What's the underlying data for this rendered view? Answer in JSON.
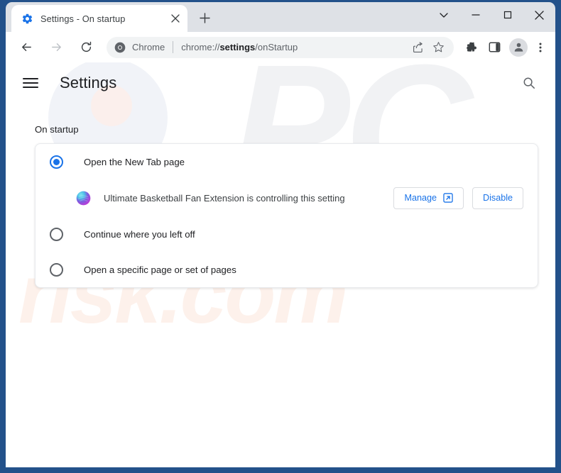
{
  "window": {
    "caption_buttons": [
      {
        "name": "tab-search",
        "icon": "chevron-down-icon"
      },
      {
        "name": "minimize",
        "icon": "minimize-icon"
      },
      {
        "name": "maximize",
        "icon": "maximize-icon"
      },
      {
        "name": "close",
        "icon": "close-icon"
      }
    ]
  },
  "tabs": [
    {
      "title": "Settings - On startup",
      "favicon": "settings-gear-icon",
      "close_icon": "close-icon",
      "active": true
    }
  ],
  "new_tab_button": {
    "icon": "plus-icon",
    "label": "+"
  },
  "toolbar": {
    "back_icon": "back-arrow-icon",
    "forward_icon": "forward-arrow-icon",
    "reload_icon": "reload-icon",
    "omnibox": {
      "brand_icon": "chrome-logo-icon",
      "brand_label": "Chrome",
      "url_prefix": "chrome://",
      "url_bold": "settings",
      "url_suffix": "/onStartup",
      "full_url": "chrome://settings/onStartup",
      "share_icon": "share-icon",
      "bookmark_icon": "star-icon"
    },
    "extensions_icon": "puzzle-piece-icon",
    "side_panel_icon": "side-panel-icon",
    "profile_icon": "person-avatar-icon",
    "menu_icon": "three-dot-menu-icon"
  },
  "settings": {
    "menu_icon": "hamburger-menu-icon",
    "title": "Settings",
    "search_icon": "search-icon",
    "section_label": "On startup",
    "options": [
      {
        "label": "Open the New Tab page",
        "selected": true
      },
      {
        "label": "Continue where you left off",
        "selected": false
      },
      {
        "label": "Open a specific page or set of pages",
        "selected": false
      }
    ],
    "extension_notice": {
      "icon": "extension-sphere-icon",
      "message": "Ultimate Basketball Fan Extension is controlling this setting",
      "manage_label": "Manage",
      "manage_icon": "open-in-new-icon",
      "disable_label": "Disable"
    }
  },
  "watermark": {
    "brand_top": "PC",
    "brand_bottom": "risk.com"
  },
  "colors": {
    "accent_blue": "#1a73e8",
    "window_frame": "#23518a",
    "tab_strip": "#dee1e6",
    "omnibox_bg": "#f1f3f4",
    "text_primary": "#202124",
    "text_secondary": "#5f6368",
    "watermark_gray": "#f1f2f4",
    "watermark_peach": "#fdf1eb"
  }
}
